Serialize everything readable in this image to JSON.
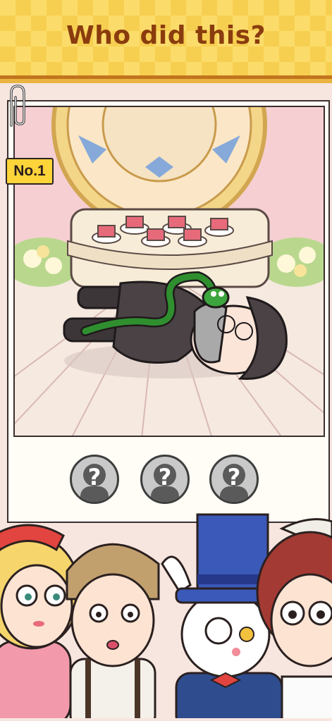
{
  "header": {
    "title": "Who did this?"
  },
  "level": {
    "tag": "No.1"
  },
  "suspect_slots": [
    {
      "label": "?"
    },
    {
      "label": "?"
    },
    {
      "label": "?"
    }
  ],
  "colors": {
    "header_yellow": "#fbdc6a",
    "header_text": "#8a3c0e",
    "tag_yellow": "#fdd439",
    "scene_pink": "#f6cfd2",
    "snake_green": "#2f8f2f"
  },
  "icons": [
    "paper-clip-icon",
    "question-mark-icon"
  ]
}
